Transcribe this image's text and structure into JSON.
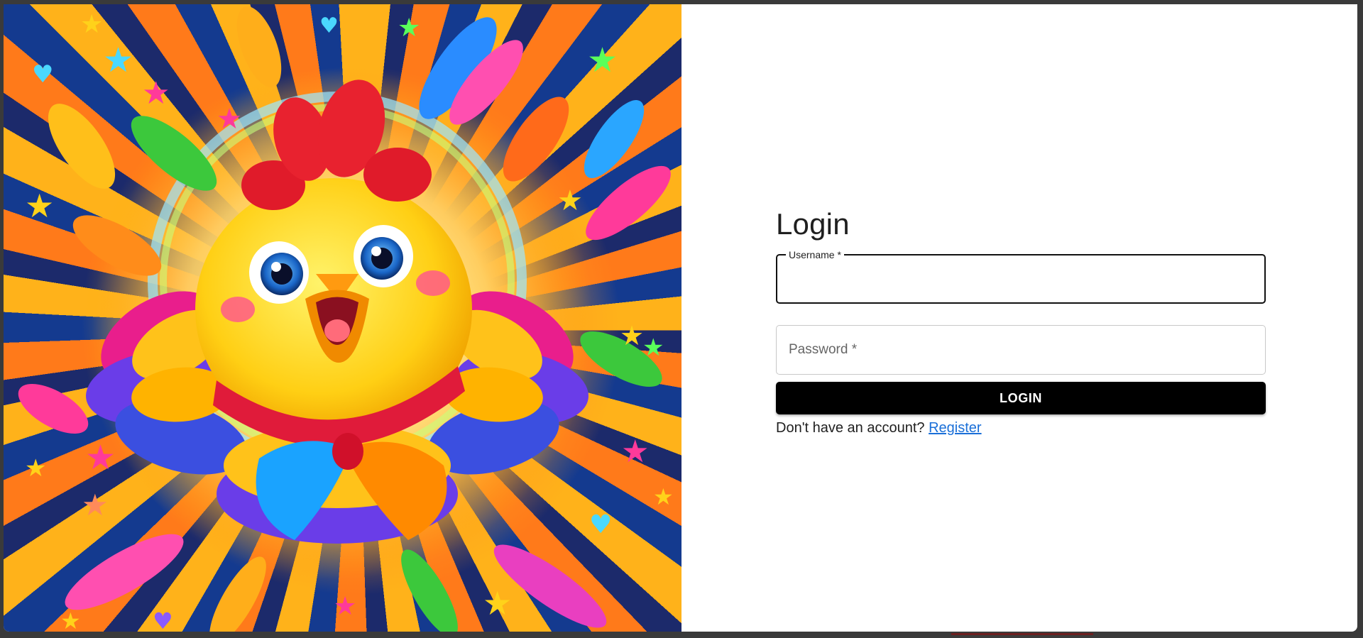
{
  "login": {
    "title": "Login",
    "username_label": "Username *",
    "password_placeholder": "Password *",
    "button_label": "LOGIN",
    "register_prompt": "Don't have an account?",
    "register_link": "Register"
  },
  "colors": {
    "button_bg": "#000000",
    "link": "#1a6fd8",
    "chick_body": "#ffd21f",
    "comb": "#e01b2a"
  },
  "icons": [
    "chick-illustration",
    "feather-icon",
    "star-icon",
    "heart-icon"
  ]
}
